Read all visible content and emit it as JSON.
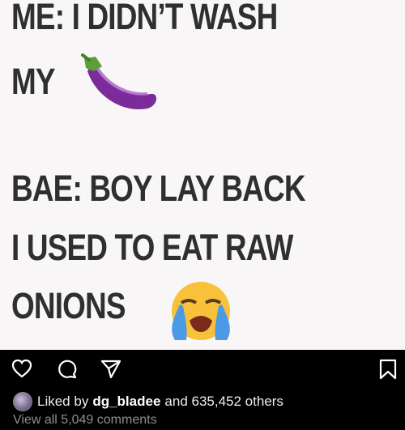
{
  "meme": {
    "line1": "ME: I DIDN’T WASH",
    "line2": "MY",
    "line3": "BAE: BOY LAY BACK",
    "line4": "I USED TO EAT RAW",
    "line5": "ONIONS",
    "emoji1": "eggplant-icon",
    "emoji2": "loudly-crying-face-icon"
  },
  "actions": {
    "icons": [
      "heart-icon",
      "comment-icon",
      "share-icon",
      "bookmark-icon"
    ]
  },
  "likes": {
    "prefix": "Liked by",
    "user": "dg_bladee",
    "suffix": "and 635,452 others"
  },
  "comments": {
    "link": "View all 5,049 comments"
  },
  "colors": {
    "background": "#000000",
    "image_bg": "#f8f6f7",
    "text": "#2f2f2f",
    "muted": "#8e8e8e"
  }
}
